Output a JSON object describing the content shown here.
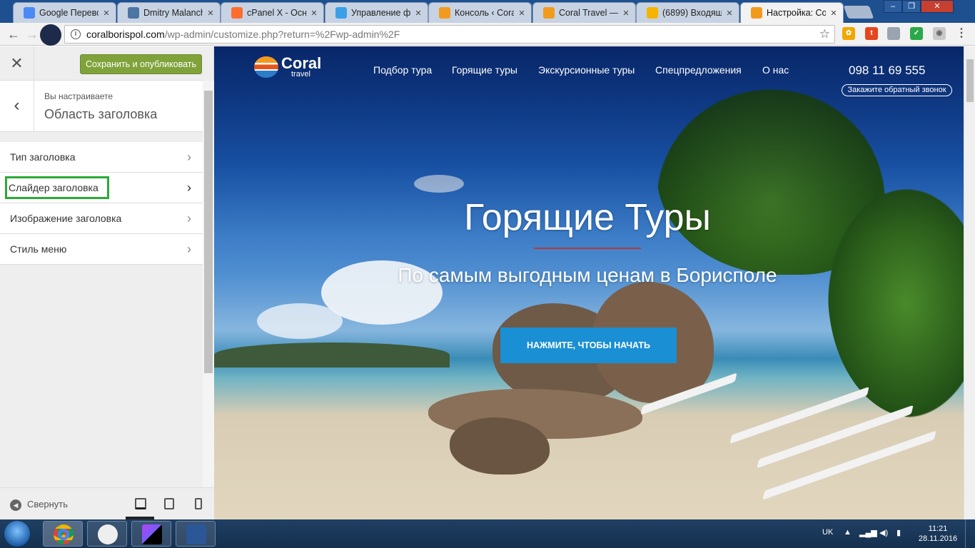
{
  "browser": {
    "tabs": [
      {
        "label": "Google Перево",
        "favicon": "google-translate-icon",
        "color": "#4a8af4"
      },
      {
        "label": "Dmitry Malanch",
        "favicon": "vk-icon",
        "color": "#4c75a3"
      },
      {
        "label": "cPanel X - Осно",
        "favicon": "cpanel-icon",
        "color": "#ff6c2c"
      },
      {
        "label": "Управление фа",
        "favicon": "1q-icon",
        "color": "#3ba0e6"
      },
      {
        "label": "Консоль ‹ Coral",
        "favicon": "coral-icon",
        "color": "#f29a1e"
      },
      {
        "label": "Coral Travel — ",
        "favicon": "coral-icon",
        "color": "#f29a1e"
      },
      {
        "label": "(6899) Входящ",
        "favicon": "mail-icon",
        "color": "#f5b400"
      },
      {
        "label": "Настройка: Cor",
        "favicon": "coral-icon",
        "color": "#f29a1e",
        "active": true
      }
    ],
    "url_host": "coralborispol.com",
    "url_path": "/wp-admin/customize.php?return=%2Fwp-admin%2F",
    "window_controls": {
      "minimize": "‒",
      "maximize": "❐",
      "close": "✕"
    }
  },
  "customizer": {
    "save_label": "Сохранить и опубликовать",
    "close_glyph": "✕",
    "back_glyph": "‹",
    "context_small": "Вы настраиваете",
    "context_title": "Область заголовка",
    "items": [
      {
        "label": "Тип заголовка"
      },
      {
        "label": "Слайдер заголовка",
        "highlighted": true
      },
      {
        "label": "Изображение заголовка"
      },
      {
        "label": "Стиль меню"
      }
    ],
    "chevron": "›",
    "collapse_label": "Свернуть"
  },
  "site": {
    "logo_main": "Coral",
    "logo_sub": "travel",
    "menu": [
      "Подбор тура",
      "Горящие туры",
      "Экскурсионные туры",
      "Спецпредложения",
      "О нас"
    ],
    "phone": "098 11 69 555",
    "callback_label": "Закажите обратный звонок",
    "hero_title": "Горящие Туры",
    "hero_subtitle": "По самым выгодным ценам в Борисполе",
    "hero_button": "НАЖМИТЕ, ЧТОБЫ НАЧАТЬ"
  },
  "taskbar": {
    "apps": [
      "chrome-icon",
      "app-icon",
      "phpstorm-icon",
      "word-icon"
    ],
    "language": "UK",
    "time": "11:21",
    "date": "28.11.2016"
  }
}
